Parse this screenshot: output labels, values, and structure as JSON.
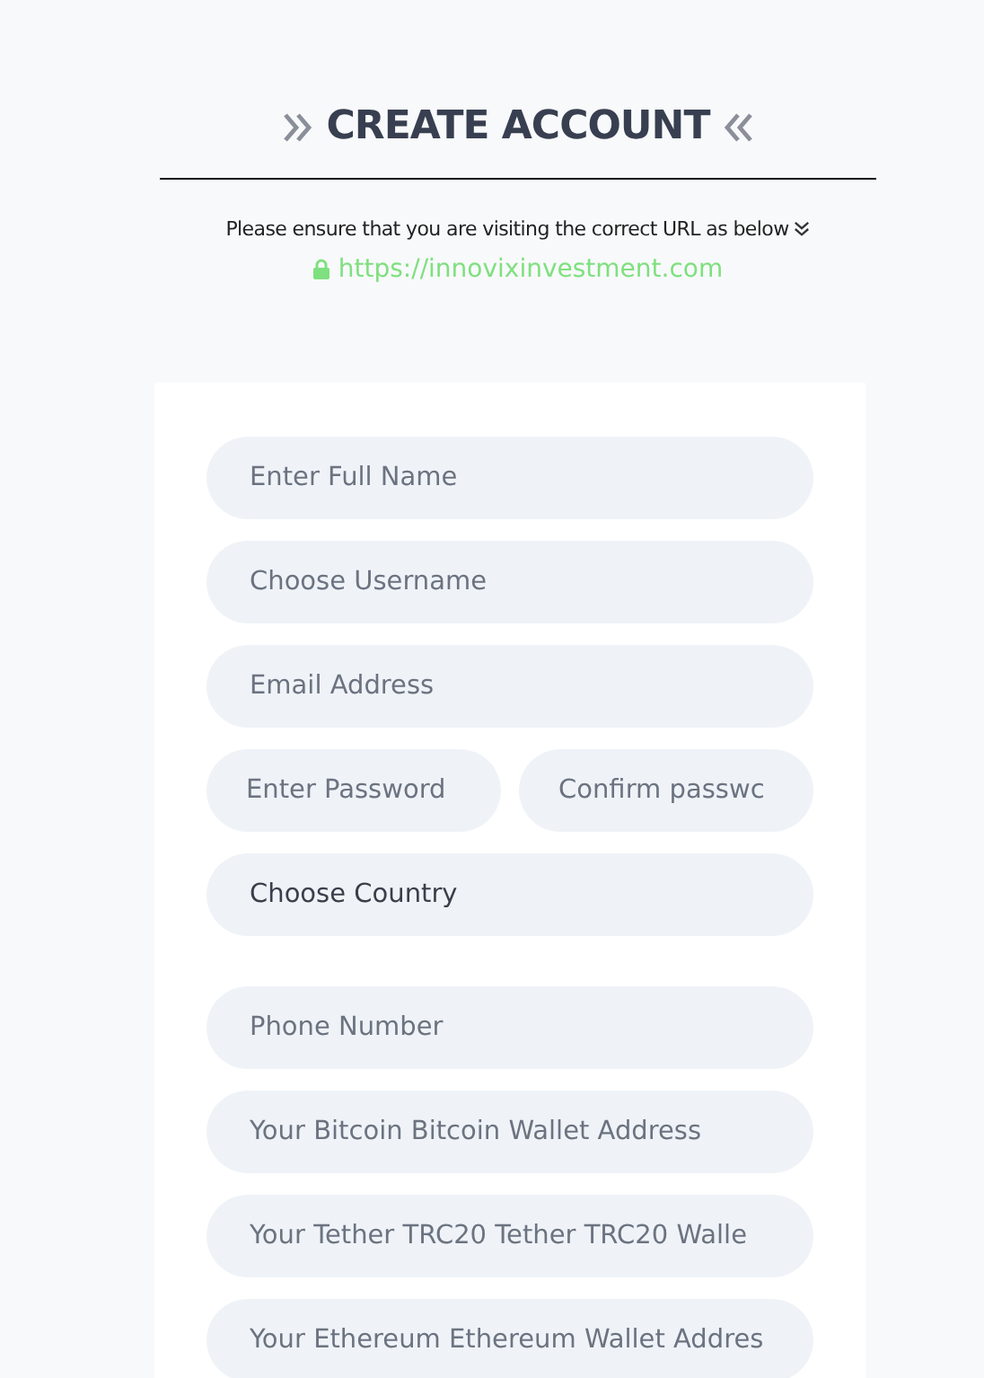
{
  "header": {
    "title": "CREATE ACCOUNT",
    "notice": "Please ensure that you are visiting the correct URL as below",
    "url": "https://innovixinvestment.com"
  },
  "form": {
    "fields": [
      {
        "kind": "input",
        "placeholder": "Enter Full Name"
      },
      {
        "kind": "input",
        "placeholder": "Choose Username"
      },
      {
        "kind": "input",
        "placeholder": "Email Address"
      },
      {
        "kind": "pair",
        "fields": [
          {
            "kind": "input",
            "placeholder": "Enter Password"
          },
          {
            "kind": "input",
            "placeholder": "Confirm passwc"
          }
        ]
      },
      {
        "kind": "select",
        "value": "Choose Country"
      },
      {
        "kind": "input",
        "placeholder": "Phone Number"
      },
      {
        "kind": "input",
        "placeholder": "Your Bitcoin Bitcoin Wallet Address"
      },
      {
        "kind": "input",
        "placeholder": "Your Tether TRC20 Tether TRC20 Walle"
      },
      {
        "kind": "input",
        "placeholder": "Your Ethereum Ethereum Wallet Addres"
      }
    ]
  }
}
